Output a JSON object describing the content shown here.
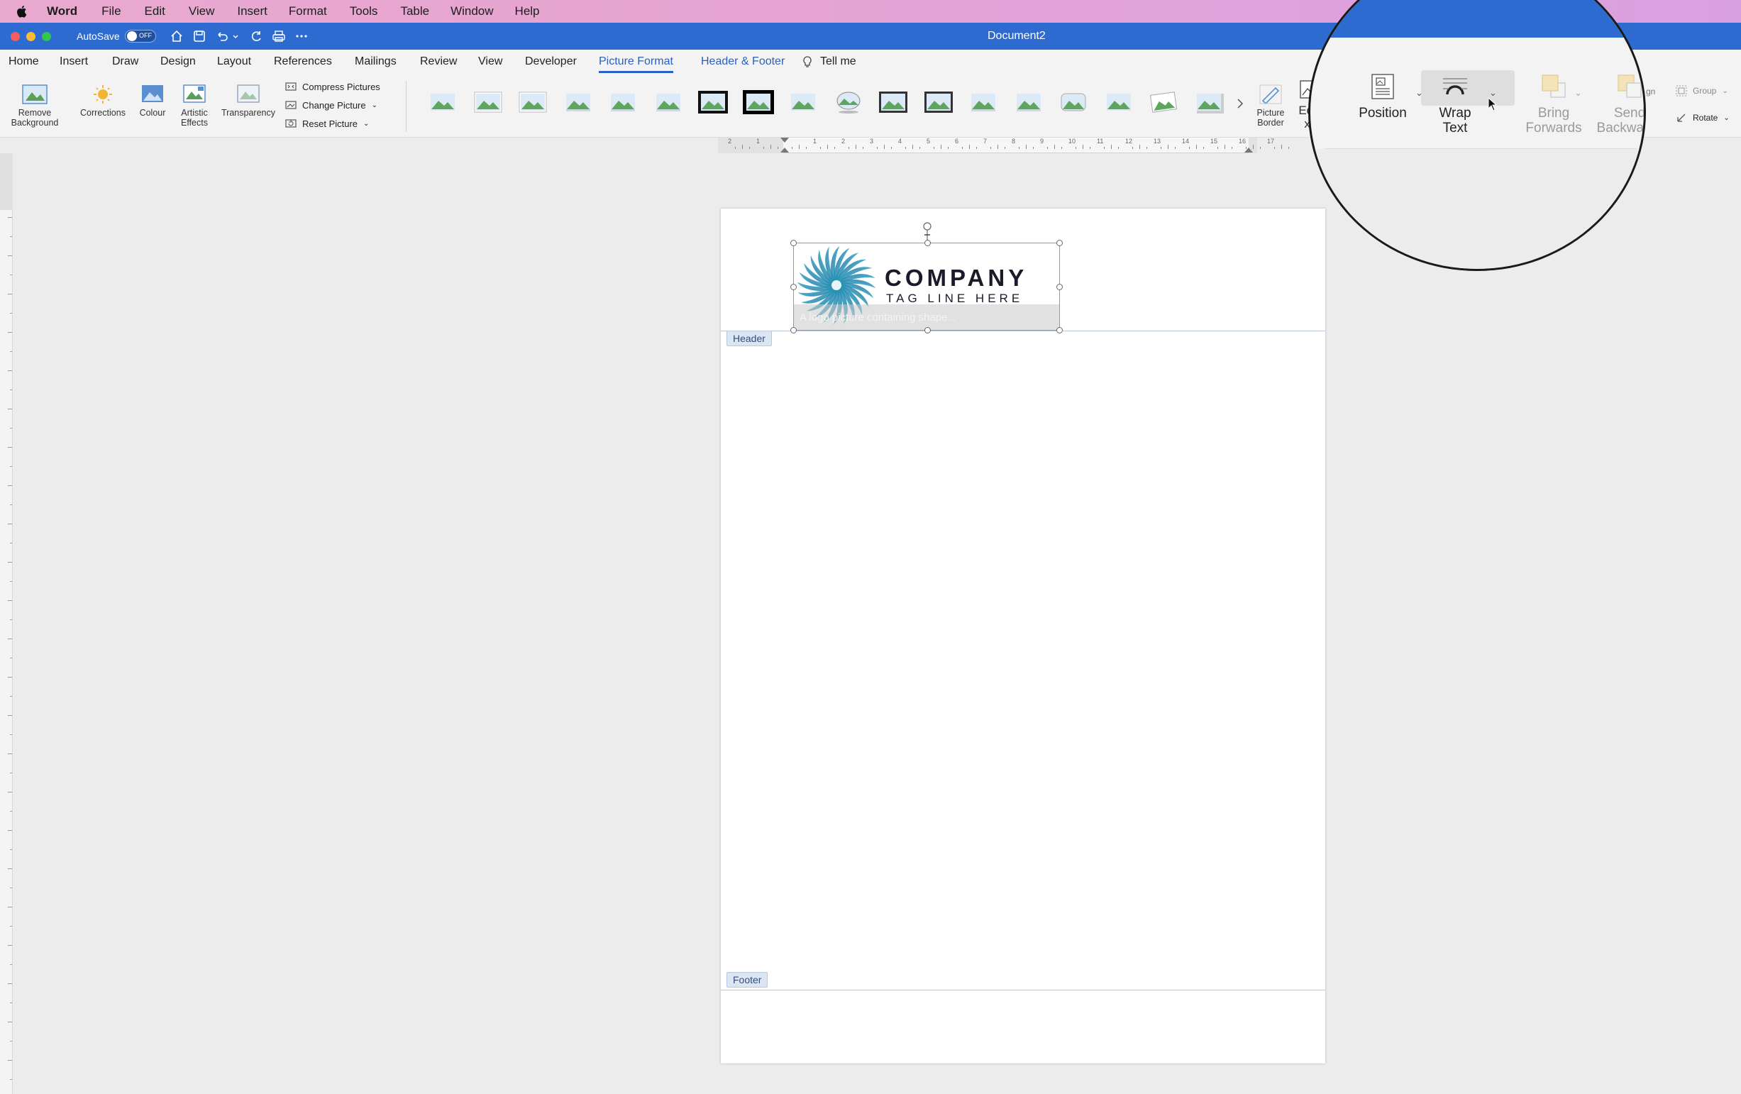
{
  "menubar": {
    "app": "Word",
    "items": [
      "File",
      "Edit",
      "View",
      "Insert",
      "Format",
      "Tools",
      "Table",
      "Window",
      "Help"
    ]
  },
  "titlebar": {
    "autosave_label": "AutoSave",
    "autosave_state": "OFF",
    "document_title": "Document2"
  },
  "tabs": [
    "Home",
    "Insert",
    "Draw",
    "Design",
    "Layout",
    "References",
    "Mailings",
    "Review",
    "View",
    "Developer",
    "Picture Format",
    "Header & Footer",
    "Tell me"
  ],
  "ribbon": {
    "remove_background": "Remove Background",
    "corrections": "Corrections",
    "colour": "Colour",
    "artistic_effects": "Artistic Effects",
    "transparency": "Transparency",
    "compress_pictures": "Compress Pictures",
    "change_picture": "Change Picture",
    "reset_picture": "Reset Picture",
    "picture_border": "Picture Border",
    "edit_alt_text_partial_1": "Edit",
    "edit_alt_text_partial_2": "xt",
    "group": "Group",
    "rotate": "Rotate",
    "align_partial": "gn"
  },
  "magnifier": {
    "position": "Position",
    "wrap_text_1": "Wrap",
    "wrap_text_2": "Text",
    "bring_forwards_1": "Bring",
    "bring_forwards_2": "Forwards",
    "send_backwards_1": "Send",
    "send_backwards_2": "Backwards",
    "partial_s": "S"
  },
  "document": {
    "header_label": "Header",
    "footer_label": "Footer",
    "logo_company": "COMPANY",
    "logo_tagline": "TAG LINE HERE",
    "alt_text": "A logo picture containing shape..."
  },
  "colors": {
    "title_blue": "#2e6bd1",
    "accent_blue": "#2b5fc0",
    "menubar_pink": "#e6a3d4"
  }
}
